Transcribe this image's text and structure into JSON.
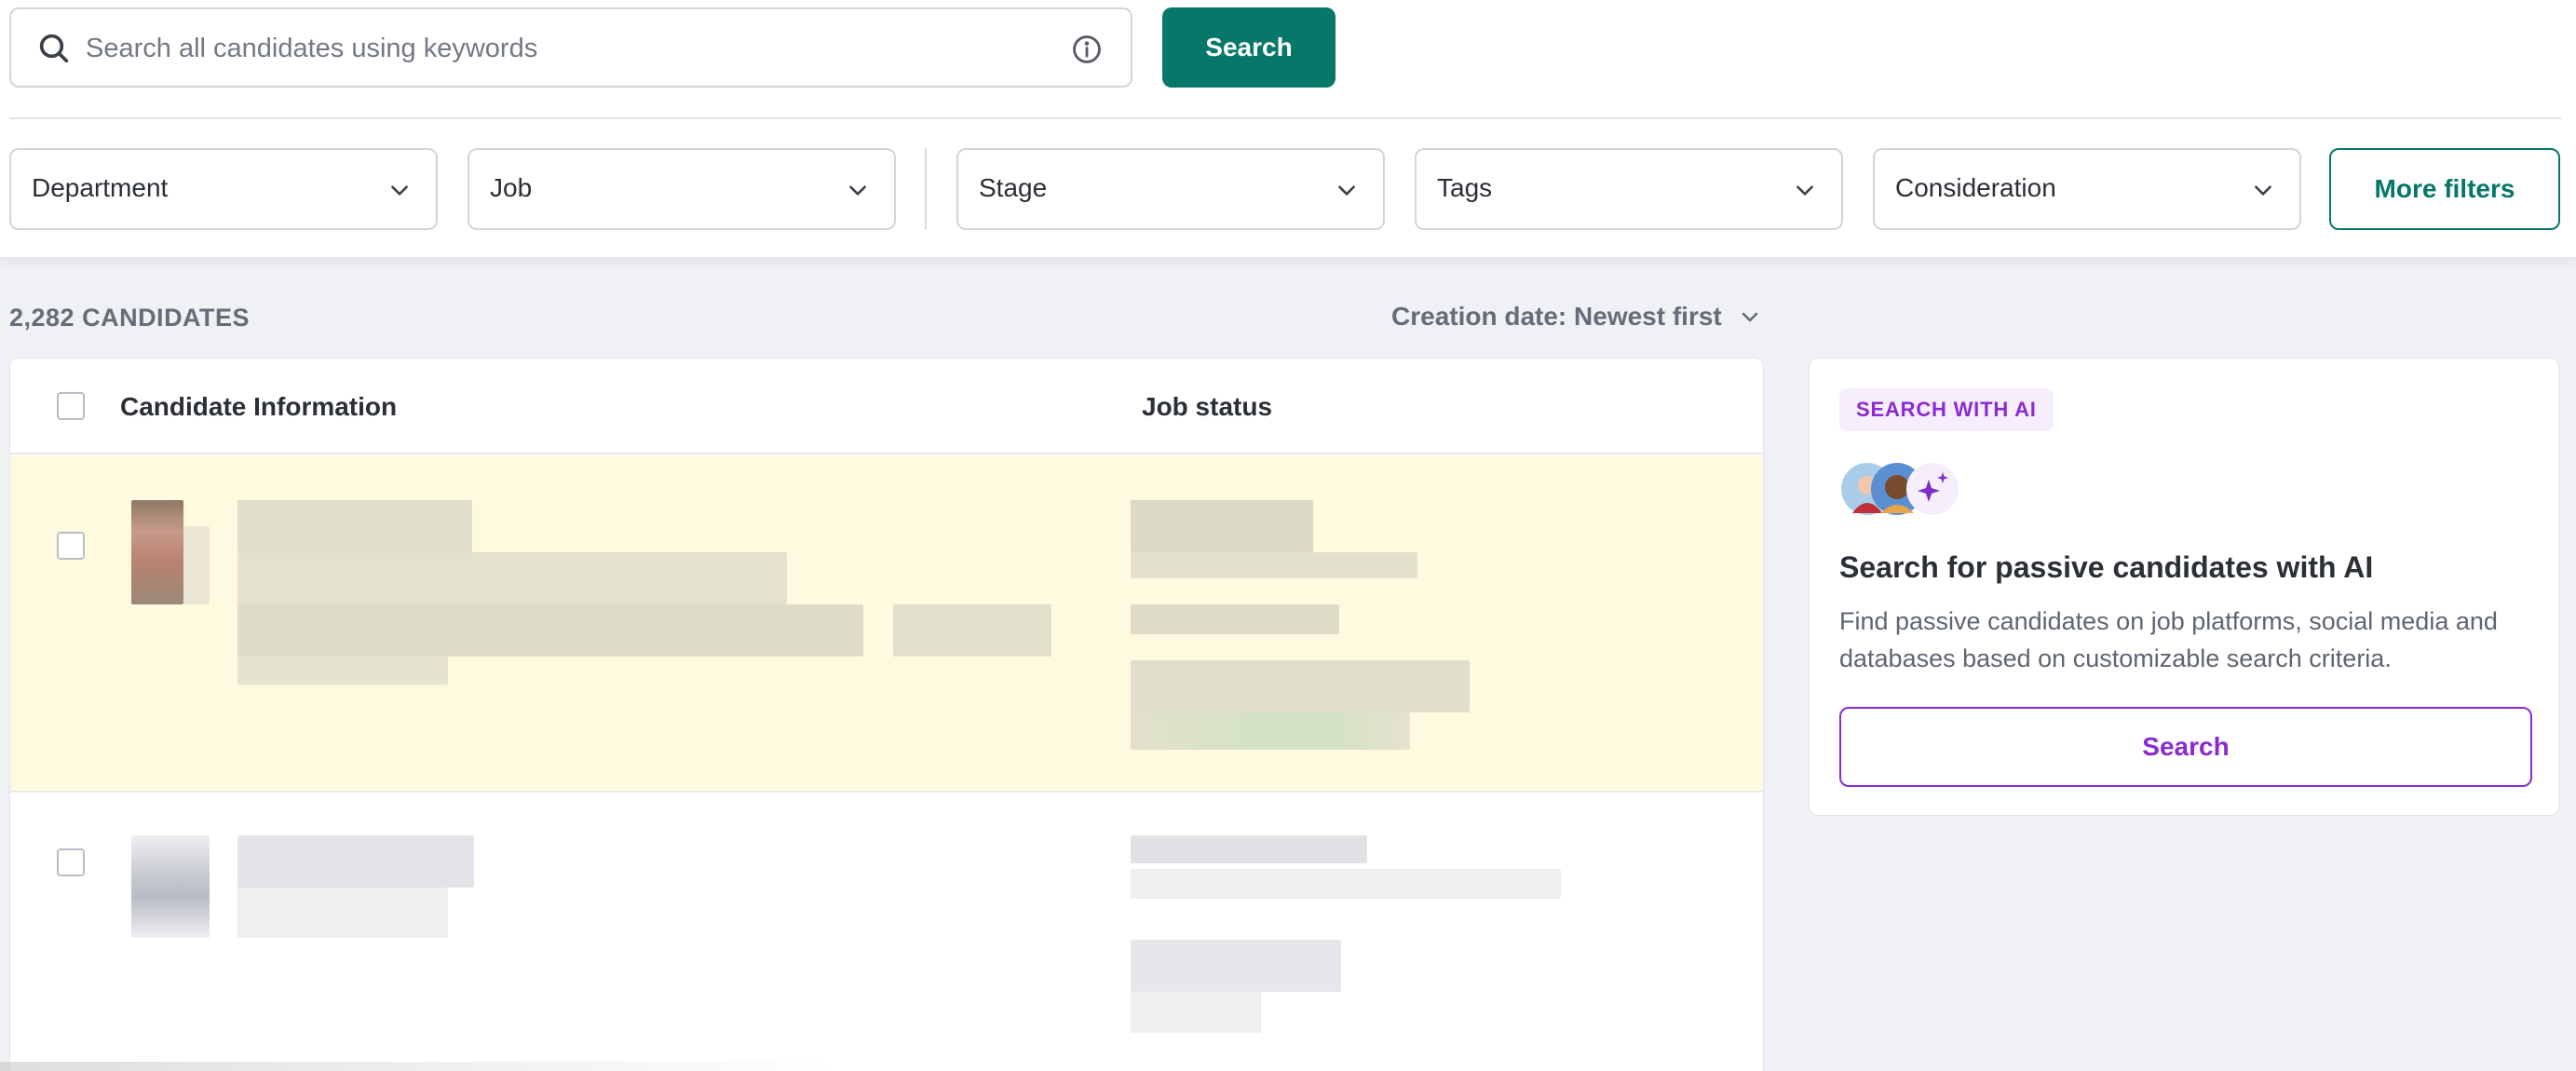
{
  "search": {
    "placeholder": "Search all candidates using keywords",
    "value": "",
    "button_label": "Search"
  },
  "filters": [
    {
      "label": "Department"
    },
    {
      "label": "Job"
    },
    {
      "label": "Stage"
    },
    {
      "label": "Tags"
    },
    {
      "label": "Consideration"
    }
  ],
  "more_filters_label": "More filters",
  "results": {
    "count_label": "2,282 CANDIDATES",
    "sort_label": "Creation date: Newest first"
  },
  "table": {
    "columns": [
      "Candidate Information",
      "Job status"
    ],
    "rows": [
      {
        "highlighted": true,
        "content": "blurred"
      },
      {
        "highlighted": false,
        "content": "blurred"
      }
    ]
  },
  "ai_panel": {
    "badge": "SEARCH WITH AI",
    "title": "Search for passive candidates with AI",
    "description": "Find passive candidates on job platforms, social media and databases based on customizable search criteria.",
    "button_label": "Search"
  },
  "colors": {
    "primary": "#067768",
    "ai_accent": "#8a2bd2",
    "highlight_row": "#fefadf",
    "page_bg": "#f0f1f4"
  },
  "icons": [
    "search-icon",
    "info-icon",
    "chevron-down-icon",
    "sparkle-icon"
  ]
}
